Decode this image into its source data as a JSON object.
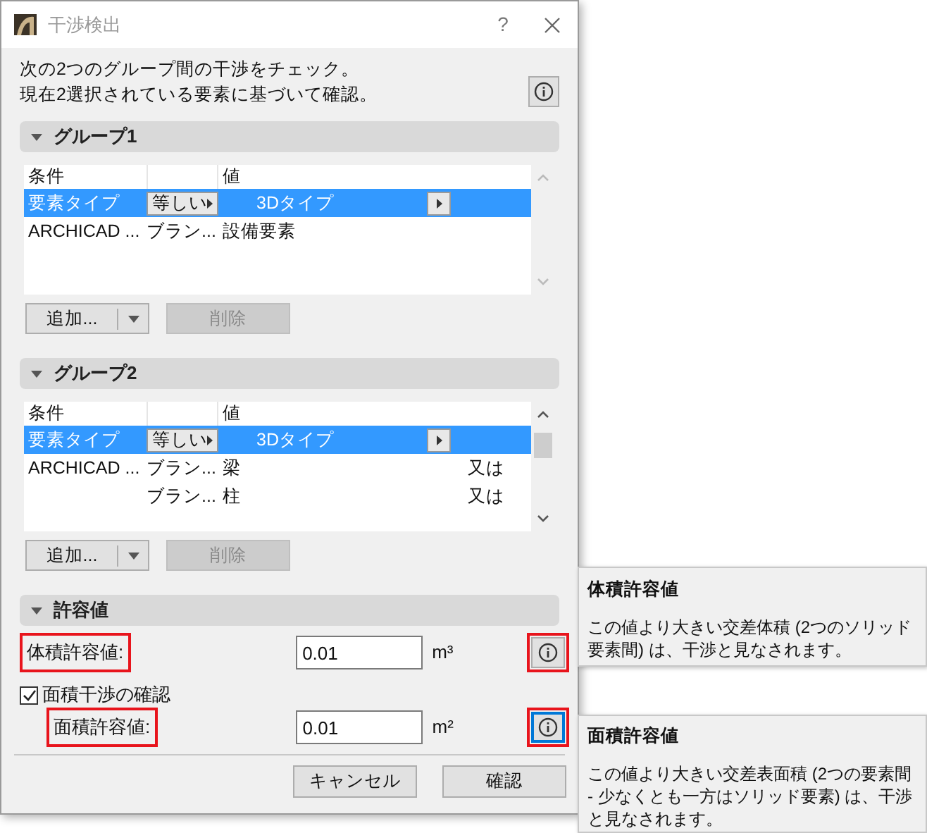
{
  "window": {
    "title": "干渉検出",
    "help": "?"
  },
  "description": [
    "次の2つのグループ間の干渉をチェック。",
    "現在2選択されている要素に基づいて確認。"
  ],
  "groups": [
    {
      "title": "グループ1",
      "expanded": true,
      "columns": [
        "条件",
        "",
        "値"
      ],
      "scrollable": false,
      "rows": [
        {
          "condition": "要素タイプ",
          "operator": "等しい",
          "value": "3Dタイプ",
          "logic": "",
          "selected": true
        },
        {
          "condition": "ARCHICAD ...",
          "operator": "ブラン...",
          "value": "設備要素",
          "logic": "",
          "selected": false
        }
      ],
      "add_button": "追加...",
      "delete_button": "削除",
      "delete_disabled": true
    },
    {
      "title": "グループ2",
      "expanded": true,
      "columns": [
        "条件",
        "",
        "値"
      ],
      "scrollable": true,
      "rows": [
        {
          "condition": "要素タイプ",
          "operator": "等しい",
          "value": "3Dタイプ",
          "logic": "",
          "selected": true
        },
        {
          "condition": "ARCHICAD ...",
          "operator": "ブラン...",
          "value": "梁",
          "logic": "又は",
          "selected": false
        },
        {
          "condition": "",
          "operator": "ブラン...",
          "value": "柱",
          "logic": "又は",
          "selected": false
        }
      ],
      "add_button": "追加...",
      "delete_button": "削除",
      "delete_disabled": true
    }
  ],
  "tolerance": {
    "title": "許容値",
    "expanded": true,
    "volume": {
      "label": "体積許容値:",
      "value": "0.01",
      "unit": "m³",
      "highlighted": true,
      "info_focused": false
    },
    "area_check": {
      "label": "面積干渉の確認",
      "checked": true
    },
    "area": {
      "label": "面積許容値:",
      "value": "0.01",
      "unit": "m²",
      "highlighted": true,
      "info_focused": true
    }
  },
  "buttons": [
    "キャンセル",
    "確認"
  ],
  "tooltips": [
    {
      "title": "体積許容値",
      "text": "この値より大きい交差体積 (2つのソリッド要素間) は、干渉と見なされます。"
    },
    {
      "title": "面積許容値",
      "text": "この値より大きい交差表面積 (2つの要素間 - 少なくとも一方はソリッド要素) は、干渉と見なされます。"
    }
  ]
}
